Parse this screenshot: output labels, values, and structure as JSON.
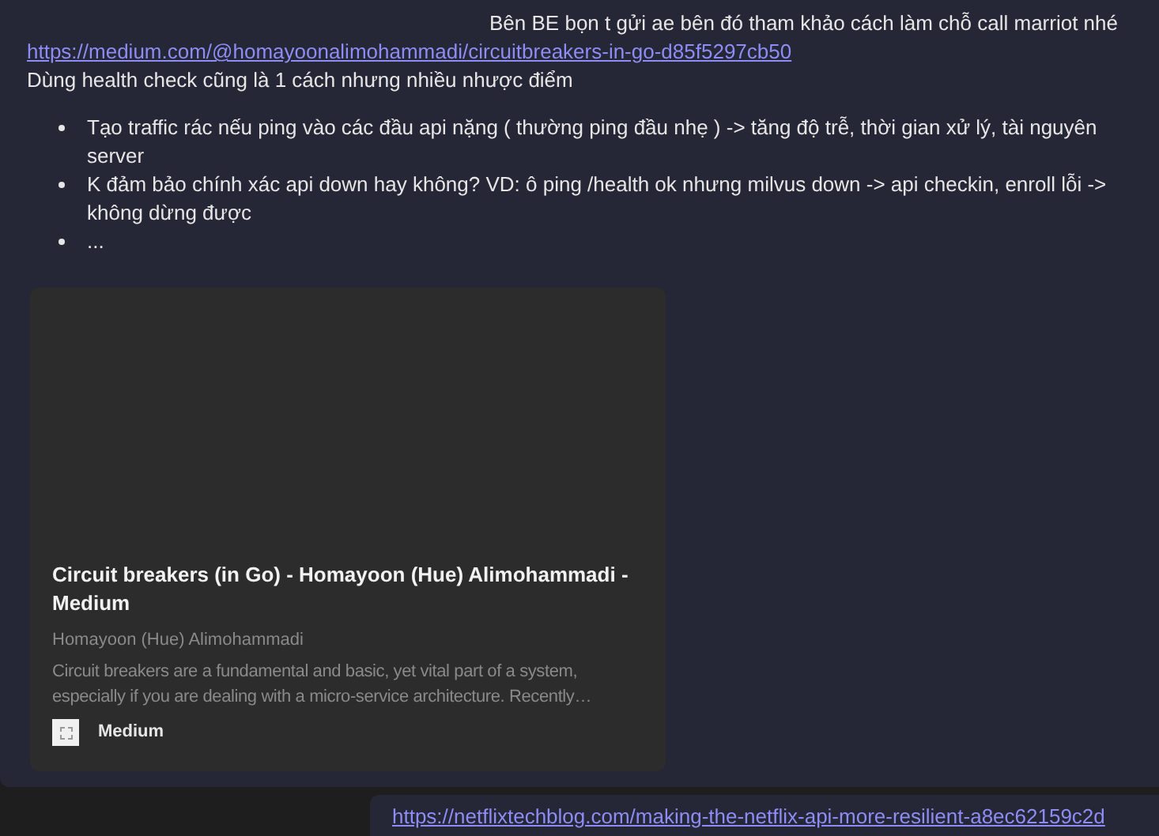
{
  "message": {
    "first_line": "Bên BE bọn t gửi ae bên đó tham khảo cách làm chỗ call marriot nhé",
    "link": "https://medium.com/@homayoonalimohammadi/circuitbreakers-in-go-d85f5297cb50",
    "intro": "Dùng health check cũng là 1 cách nhưng nhiều nhược điểm",
    "bullets": [
      "Tạo traffic rác nếu ping vào các đầu api nặng ( thường ping đầu nhẹ ) -> tăng độ trễ, thời gian xử lý, tài nguyên server",
      "K đảm bảo chính xác api down hay không? VD: ô ping /health ok nhưng milvus down -> api checkin, enroll lỗi -> không dừng được",
      "..."
    ],
    "preview": {
      "title": "Circuit breakers (in Go) - Homayoon (Hue) Alimohammadi - Medium",
      "author": "Homayoon (Hue) Alimohammadi",
      "description": "Circuit breakers are a fundamental and basic, yet vital part of a system, especially if you are dealing with a micro-service architecture. Recently…",
      "site": "Medium"
    }
  },
  "next_message": {
    "link": "https://netflixtechblog.com/making-the-netflix-api-more-resilient-a8ec62159c2d"
  }
}
